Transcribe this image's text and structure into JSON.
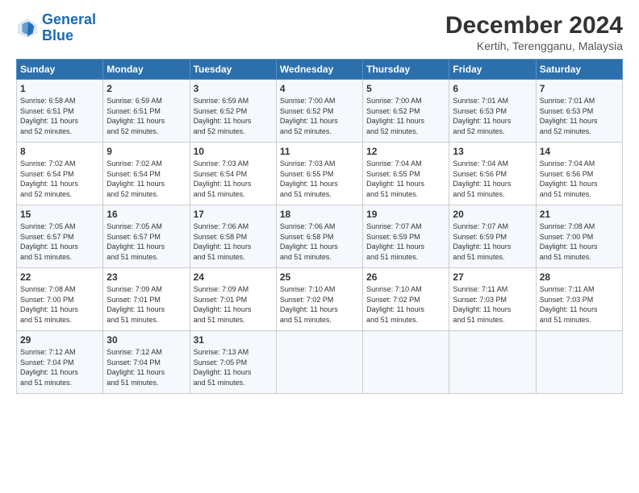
{
  "header": {
    "logo_line1": "General",
    "logo_line2": "Blue",
    "month": "December 2024",
    "location": "Kertih, Terengganu, Malaysia"
  },
  "days_of_week": [
    "Sunday",
    "Monday",
    "Tuesday",
    "Wednesday",
    "Thursday",
    "Friday",
    "Saturday"
  ],
  "weeks": [
    [
      {
        "day": "1",
        "info": "Sunrise: 6:58 AM\nSunset: 6:51 PM\nDaylight: 11 hours\nand 52 minutes."
      },
      {
        "day": "2",
        "info": "Sunrise: 6:59 AM\nSunset: 6:51 PM\nDaylight: 11 hours\nand 52 minutes."
      },
      {
        "day": "3",
        "info": "Sunrise: 6:59 AM\nSunset: 6:52 PM\nDaylight: 11 hours\nand 52 minutes."
      },
      {
        "day": "4",
        "info": "Sunrise: 7:00 AM\nSunset: 6:52 PM\nDaylight: 11 hours\nand 52 minutes."
      },
      {
        "day": "5",
        "info": "Sunrise: 7:00 AM\nSunset: 6:52 PM\nDaylight: 11 hours\nand 52 minutes."
      },
      {
        "day": "6",
        "info": "Sunrise: 7:01 AM\nSunset: 6:53 PM\nDaylight: 11 hours\nand 52 minutes."
      },
      {
        "day": "7",
        "info": "Sunrise: 7:01 AM\nSunset: 6:53 PM\nDaylight: 11 hours\nand 52 minutes."
      }
    ],
    [
      {
        "day": "8",
        "info": "Sunrise: 7:02 AM\nSunset: 6:54 PM\nDaylight: 11 hours\nand 52 minutes."
      },
      {
        "day": "9",
        "info": "Sunrise: 7:02 AM\nSunset: 6:54 PM\nDaylight: 11 hours\nand 52 minutes."
      },
      {
        "day": "10",
        "info": "Sunrise: 7:03 AM\nSunset: 6:54 PM\nDaylight: 11 hours\nand 51 minutes."
      },
      {
        "day": "11",
        "info": "Sunrise: 7:03 AM\nSunset: 6:55 PM\nDaylight: 11 hours\nand 51 minutes."
      },
      {
        "day": "12",
        "info": "Sunrise: 7:04 AM\nSunset: 6:55 PM\nDaylight: 11 hours\nand 51 minutes."
      },
      {
        "day": "13",
        "info": "Sunrise: 7:04 AM\nSunset: 6:56 PM\nDaylight: 11 hours\nand 51 minutes."
      },
      {
        "day": "14",
        "info": "Sunrise: 7:04 AM\nSunset: 6:56 PM\nDaylight: 11 hours\nand 51 minutes."
      }
    ],
    [
      {
        "day": "15",
        "info": "Sunrise: 7:05 AM\nSunset: 6:57 PM\nDaylight: 11 hours\nand 51 minutes."
      },
      {
        "day": "16",
        "info": "Sunrise: 7:05 AM\nSunset: 6:57 PM\nDaylight: 11 hours\nand 51 minutes."
      },
      {
        "day": "17",
        "info": "Sunrise: 7:06 AM\nSunset: 6:58 PM\nDaylight: 11 hours\nand 51 minutes."
      },
      {
        "day": "18",
        "info": "Sunrise: 7:06 AM\nSunset: 6:58 PM\nDaylight: 11 hours\nand 51 minutes."
      },
      {
        "day": "19",
        "info": "Sunrise: 7:07 AM\nSunset: 6:59 PM\nDaylight: 11 hours\nand 51 minutes."
      },
      {
        "day": "20",
        "info": "Sunrise: 7:07 AM\nSunset: 6:59 PM\nDaylight: 11 hours\nand 51 minutes."
      },
      {
        "day": "21",
        "info": "Sunrise: 7:08 AM\nSunset: 7:00 PM\nDaylight: 11 hours\nand 51 minutes."
      }
    ],
    [
      {
        "day": "22",
        "info": "Sunrise: 7:08 AM\nSunset: 7:00 PM\nDaylight: 11 hours\nand 51 minutes."
      },
      {
        "day": "23",
        "info": "Sunrise: 7:09 AM\nSunset: 7:01 PM\nDaylight: 11 hours\nand 51 minutes."
      },
      {
        "day": "24",
        "info": "Sunrise: 7:09 AM\nSunset: 7:01 PM\nDaylight: 11 hours\nand 51 minutes."
      },
      {
        "day": "25",
        "info": "Sunrise: 7:10 AM\nSunset: 7:02 PM\nDaylight: 11 hours\nand 51 minutes."
      },
      {
        "day": "26",
        "info": "Sunrise: 7:10 AM\nSunset: 7:02 PM\nDaylight: 11 hours\nand 51 minutes."
      },
      {
        "day": "27",
        "info": "Sunrise: 7:11 AM\nSunset: 7:03 PM\nDaylight: 11 hours\nand 51 minutes."
      },
      {
        "day": "28",
        "info": "Sunrise: 7:11 AM\nSunset: 7:03 PM\nDaylight: 11 hours\nand 51 minutes."
      }
    ],
    [
      {
        "day": "29",
        "info": "Sunrise: 7:12 AM\nSunset: 7:04 PM\nDaylight: 11 hours\nand 51 minutes."
      },
      {
        "day": "30",
        "info": "Sunrise: 7:12 AM\nSunset: 7:04 PM\nDaylight: 11 hours\nand 51 minutes."
      },
      {
        "day": "31",
        "info": "Sunrise: 7:13 AM\nSunset: 7:05 PM\nDaylight: 11 hours\nand 51 minutes."
      },
      {
        "day": "",
        "info": ""
      },
      {
        "day": "",
        "info": ""
      },
      {
        "day": "",
        "info": ""
      },
      {
        "day": "",
        "info": ""
      }
    ]
  ]
}
